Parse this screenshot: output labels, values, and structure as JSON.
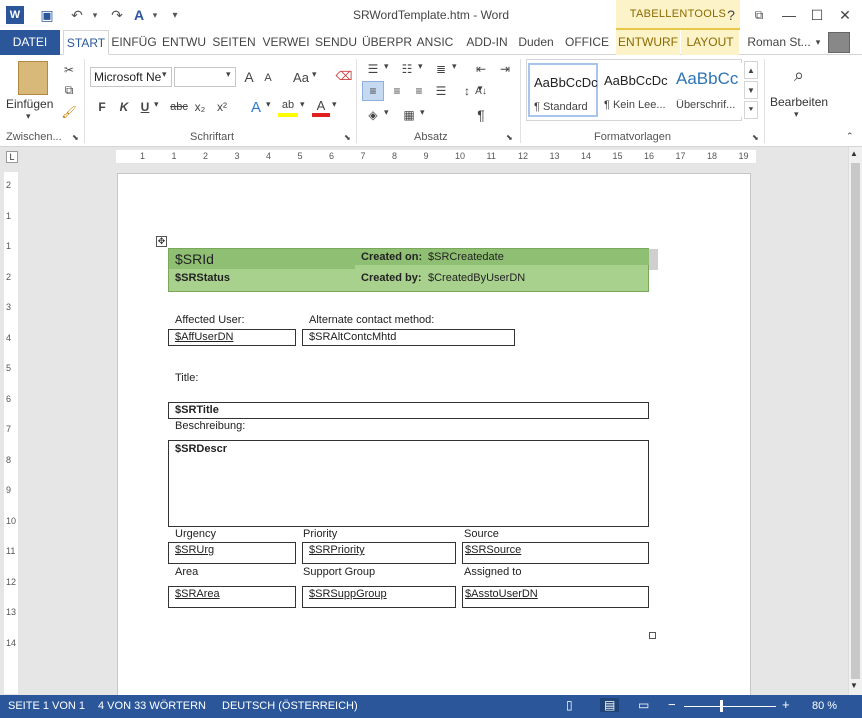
{
  "window": {
    "title": "SRWordTemplate.htm - Word",
    "help": "?",
    "minimize": "—",
    "restore": "❐",
    "close": "✕"
  },
  "quick_access": {
    "word_icon": "W",
    "save": "💾",
    "undo": "↶",
    "redo": "↷",
    "spell": "A",
    "customize": "▾"
  },
  "tabletools": "TABELLENTOOLS",
  "tabs": [
    "DATEI",
    "START",
    "EINFÜG",
    "ENTWU",
    "SEITEN",
    "VERWEI",
    "SENDU",
    "ÜBERPR",
    "ANSIC",
    "ADD-IN",
    "Duden",
    "OFFICE"
  ],
  "tt_tabs": [
    "ENTWURF",
    "LAYOUT"
  ],
  "user": "Roman St...",
  "ribbon": {
    "clipboard_label": "Zwischen...",
    "paste_label": "Einfügen",
    "font_label": "Schriftart",
    "font_name": "Microsoft Ne",
    "font_size": "",
    "para_label": "Absatz",
    "styles_label": "Formatvorlagen",
    "styles": [
      {
        "preview": "AaBbCcDc",
        "name": "¶ Standard"
      },
      {
        "preview": "AaBbCcDc",
        "name": "¶ Kein Lee..."
      },
      {
        "preview": "AaBbCc",
        "name": "Überschrif..."
      }
    ],
    "edit_label": "Bearbeiten",
    "bold": "F",
    "italic": "K",
    "underline": "U",
    "strike": "abc",
    "sub": "x₂",
    "sup": "x²",
    "grow": "A",
    "shrink": "A",
    "case": "Aa",
    "pilcrow": "¶"
  },
  "ruler": {
    "h_numbers": [
      "1",
      "1",
      "2",
      "3",
      "4",
      "5",
      "6",
      "7",
      "8",
      "9",
      "10",
      "11",
      "12",
      "13",
      "14",
      "15",
      "16",
      "17",
      "18",
      "19"
    ],
    "v_numbers": [
      "2",
      "1",
      "1",
      "2",
      "3",
      "4",
      "5",
      "6",
      "7",
      "8",
      "9",
      "10",
      "11",
      "12",
      "13",
      "14"
    ]
  },
  "doc": {
    "srid": "$SRId",
    "created_on_label": "Created on:",
    "created_on_value": "$SRCreatedate",
    "srstatus": "$SRStatus",
    "created_by_label": "Created by:",
    "created_by_value": "$CreatedByUserDN",
    "affected_user_label": "Affected User:",
    "affected_user_value": "$AffUserDN",
    "alt_contact_label": "Alternate contact method:",
    "alt_contact_value": "$SRAltContcMhtd",
    "title_label": "Title:",
    "title_value": "$SRTitle",
    "desc_label": "Beschreibung:",
    "desc_value": "$SRDescr",
    "urgency_label": "Urgency",
    "urgency_value": "$SRUrg",
    "priority_label": "Priority",
    "priority_value": "$SRPriority",
    "source_label": "Source",
    "source_value": "$SRSource",
    "area_label": "Area",
    "area_value": "$SRArea",
    "support_group_label": "Support Group",
    "support_group_value": "$SRSuppGroup",
    "assigned_label": "Assigned to",
    "assigned_value": "$AsstoUserDN"
  },
  "status": {
    "page": "SEITE 1 VON 1",
    "words": "4 VON 33 WÖRTERN",
    "lang": "DEUTSCH (ÖSTERREICH)",
    "zoom": "80 %"
  },
  "colors": {
    "accent": "#2b579a",
    "table_green": "#a9d18e",
    "table_dark": "#8fbf72"
  }
}
